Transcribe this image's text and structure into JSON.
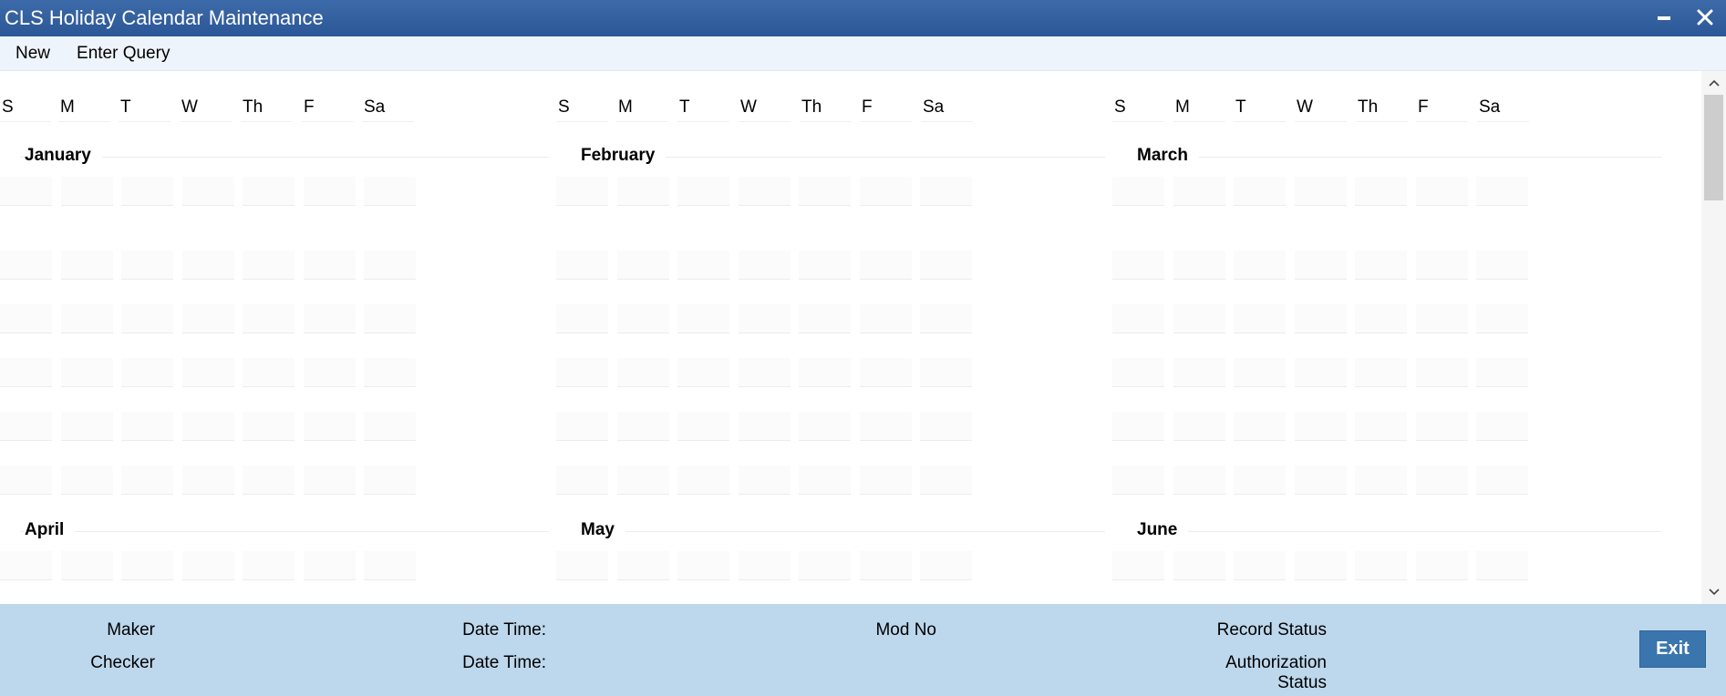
{
  "window": {
    "title": "CLS Holiday Calendar Maintenance"
  },
  "toolbar": {
    "new_label": "New",
    "enter_query_label": "Enter Query"
  },
  "weekdays": [
    "S",
    "M",
    "T",
    "W",
    "Th",
    "F",
    "Sa"
  ],
  "months": [
    "January",
    "February",
    "March",
    "April",
    "May",
    "June"
  ],
  "footer": {
    "maker_label": "Maker",
    "checker_label": "Checker",
    "date_time_label_1": "Date Time:",
    "date_time_label_2": "Date Time:",
    "mod_no_label": "Mod No",
    "record_status_label": "Record Status",
    "authorization_status_label_line1": "Authorization",
    "authorization_status_label_line2": "Status",
    "exit_label": "Exit"
  },
  "colors": {
    "titlebar": "#2b5797",
    "footer": "#bdd7ec",
    "exit_button": "#3a76ad"
  }
}
